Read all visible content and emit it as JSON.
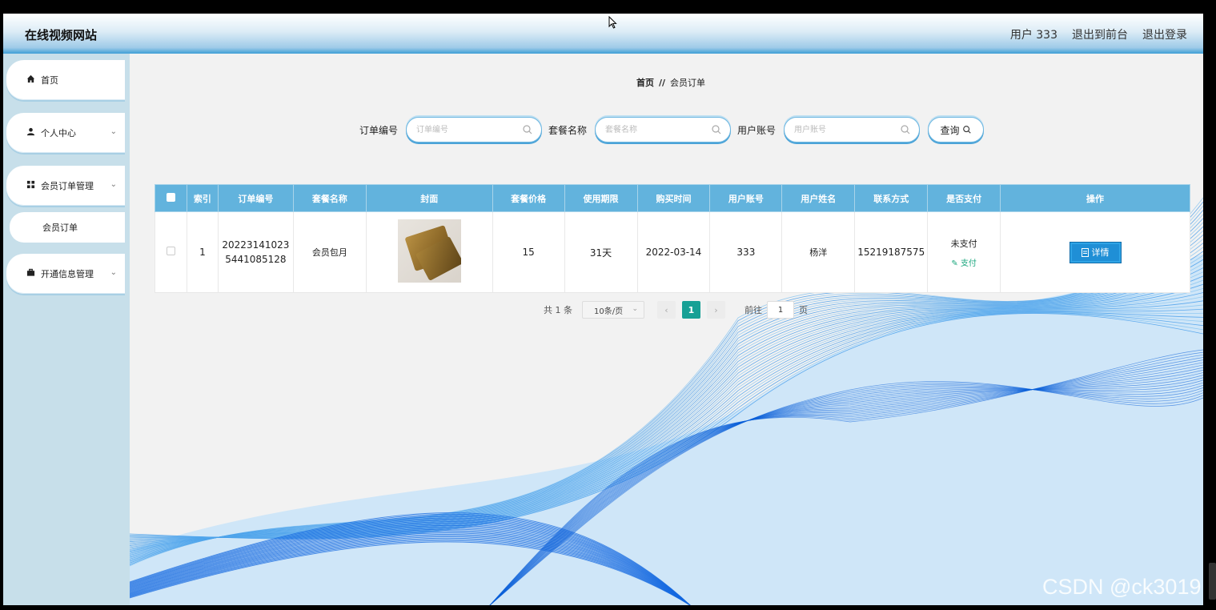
{
  "header": {
    "site_title": "在线视频网站",
    "user": "用户 333",
    "to_front": "退出到前台",
    "logout": "退出登录"
  },
  "sidebar": {
    "home": "首页",
    "personal": "个人中心",
    "member_order_mgmt": "会员订单管理",
    "member_order": "会员订单",
    "open_info_mgmt": "开通信息管理"
  },
  "breadcrumb": {
    "home": "首页",
    "sep": "//",
    "current": "会员订单"
  },
  "search": {
    "order_no_label": "订单编号",
    "order_no_placeholder": "订单编号",
    "package_label": "套餐名称",
    "package_placeholder": "套餐名称",
    "account_label": "用户账号",
    "account_placeholder": "用户账号",
    "query_label": "查询"
  },
  "table": {
    "headers": [
      "索引",
      "订单编号",
      "套餐名称",
      "封面",
      "套餐价格",
      "使用期限",
      "购买时间",
      "用户账号",
      "用户姓名",
      "联系方式",
      "是否支付",
      "操作"
    ],
    "rows": [
      {
        "index": "1",
        "order_no_1": "20223141023",
        "order_no_2": "5441085128",
        "package": "会员包月",
        "price": "15",
        "term": "31天",
        "buy_time": "2022-03-14",
        "account": "333",
        "name": "杨洋",
        "phone": "15219187575",
        "paid": "未支付",
        "pay_action": "支付",
        "detail": "详情"
      }
    ]
  },
  "pagination": {
    "total": "共 1 条",
    "page_size": "10条/页",
    "current": "1",
    "goto": "前往",
    "goto_value": "1",
    "page_unit": "页"
  },
  "watermark": "CSDN @ck3019",
  "colors": {
    "table_header": "#62b3dd",
    "active_page": "#17a095",
    "detail_button": "#1f8fd6",
    "pay_link": "#19a67d"
  }
}
